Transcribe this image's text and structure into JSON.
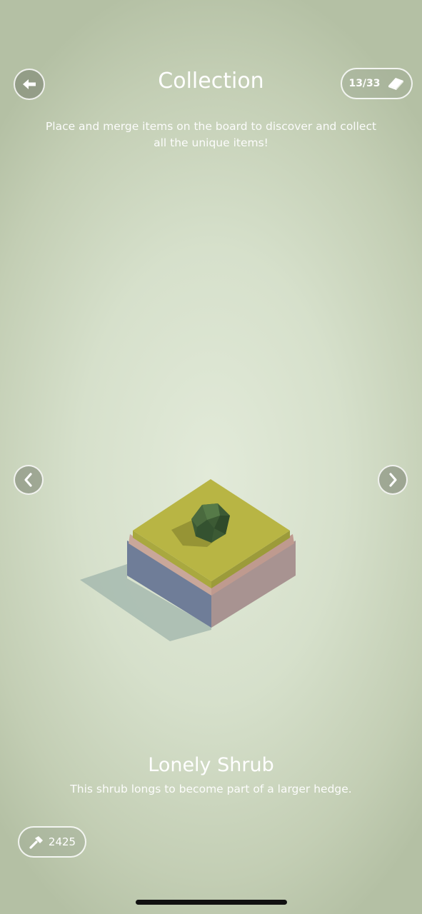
{
  "header": {
    "title": "Collection",
    "subtitle": "Place and merge items on the board to discover and collect all the unique items!",
    "progress": "13/33",
    "back_icon": "arrow-left-icon",
    "book_icon": "book-icon"
  },
  "item": {
    "name": "Lonely Shrub",
    "description": "This shrub longs to become part of a larger hedge."
  },
  "navigation": {
    "prev_icon": "chevron-left-icon",
    "next_icon": "chevron-right-icon"
  },
  "footer": {
    "hammer_count": "2425",
    "hammer_icon": "hammer-icon"
  },
  "colors": {
    "grass_top": "#b8b544",
    "grass_side": "#a9a83f",
    "soil_stripe": "#c9a79a",
    "stone_side": "#6f7d98",
    "shrub": "#3c5a34"
  }
}
